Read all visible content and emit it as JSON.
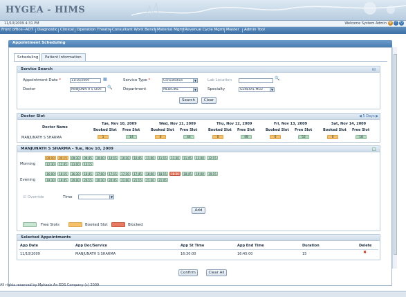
{
  "app": {
    "title": "HYGEA - HIMS"
  },
  "topbar": {
    "datetime": "11/10/2009 4:31 PM",
    "welcome": "Welcome System Admin"
  },
  "menu": [
    "Front office--ADT",
    "Diagnostic",
    "Clinical",
    "Operation Theatre",
    "Consultant Work Bench",
    "Material Mgmt",
    "Revenue Cycle Mgmt",
    "Master",
    "Admin Tool"
  ],
  "panel": {
    "title": "Appointment Scheduling"
  },
  "tabs": [
    "Scheduling",
    "Patient Information"
  ],
  "service_search": {
    "title": "Service Search",
    "appointment_date_label": "Appointment Date",
    "appointment_date": "11/10/2009",
    "service_type_label": "Service Type",
    "service_type": "Consultation",
    "lab_location_label": "Lab Location",
    "lab_location": "",
    "doctor_label": "Doctor",
    "doctor": "MANJUNATH S SHAI",
    "department_label": "Department",
    "department": "MEDICINE",
    "specialty_label": "Specialty",
    "specialty": "GENERAL MED",
    "search_label": "Search",
    "clear_label": "Clear"
  },
  "doctor_slot": {
    "title": "Doctor Slot",
    "nav": "5 Days",
    "doctor_name_header": "Doctor Name",
    "booked_label": "Booked Slot",
    "free_label": "Free Slot",
    "days": [
      "Tue, Nov 10, 2009",
      "Wed, Nov 11, 2009",
      "Thu, Nov 12, 2009",
      "Fri, Nov 13, 2009",
      "Sat, Nov 14, 2009"
    ],
    "doctor": "MANJUNATH S SHARMA",
    "booked": [
      "1",
      "0",
      "0",
      "0",
      "0"
    ],
    "free": [
      "14",
      "44",
      "48",
      "52",
      "18"
    ]
  },
  "schedule": {
    "title": "MANJUNATH S SHARMA - Tue, Nov 10, 2009",
    "morning_label": "Morning",
    "evening_label": "Evening",
    "morning_slots": [
      "09:00",
      "09:15",
      "09:30",
      "09:45",
      "10:00",
      "10:15",
      "10:30",
      "10:45",
      "11:00",
      "11:15",
      "11:30",
      "11:45",
      "12:00",
      "12:15",
      "12:30",
      "12:45",
      "13:00",
      "13:15"
    ],
    "evening_slots": [
      "16:00",
      "16:15",
      "16:30",
      "16:45",
      "17:00",
      "17:15",
      "17:30",
      "17:45",
      "18:00",
      "18:15",
      "18:30",
      "18:45",
      "19:00",
      "19:15",
      "19:30",
      "19:45",
      "20:00",
      "20:15",
      "20:30",
      "20:45",
      "21:00",
      "21:15",
      "21:30",
      "21:45"
    ],
    "override_label": "Override",
    "time_label": "Time",
    "add_label": "Add",
    "legend_free": "Free Slots",
    "legend_booked": "Booked Slot",
    "legend_blocked": "Blocked"
  },
  "selected": {
    "title": "Selected Appointments",
    "headers": [
      "App Date",
      "App Doc/Service",
      "App St Time",
      "App End Time",
      "Duration",
      "Delete"
    ],
    "rows": [
      [
        "11/10/2009",
        "MANJUNATH S SHARMA",
        "16:30:00",
        "16:45:00",
        "15"
      ]
    ]
  },
  "actions": {
    "confirm": "Confirm",
    "clear_all": "Clear All"
  },
  "footer": "All rights reserved by Mphasis An EDS Company (c) 2009"
}
